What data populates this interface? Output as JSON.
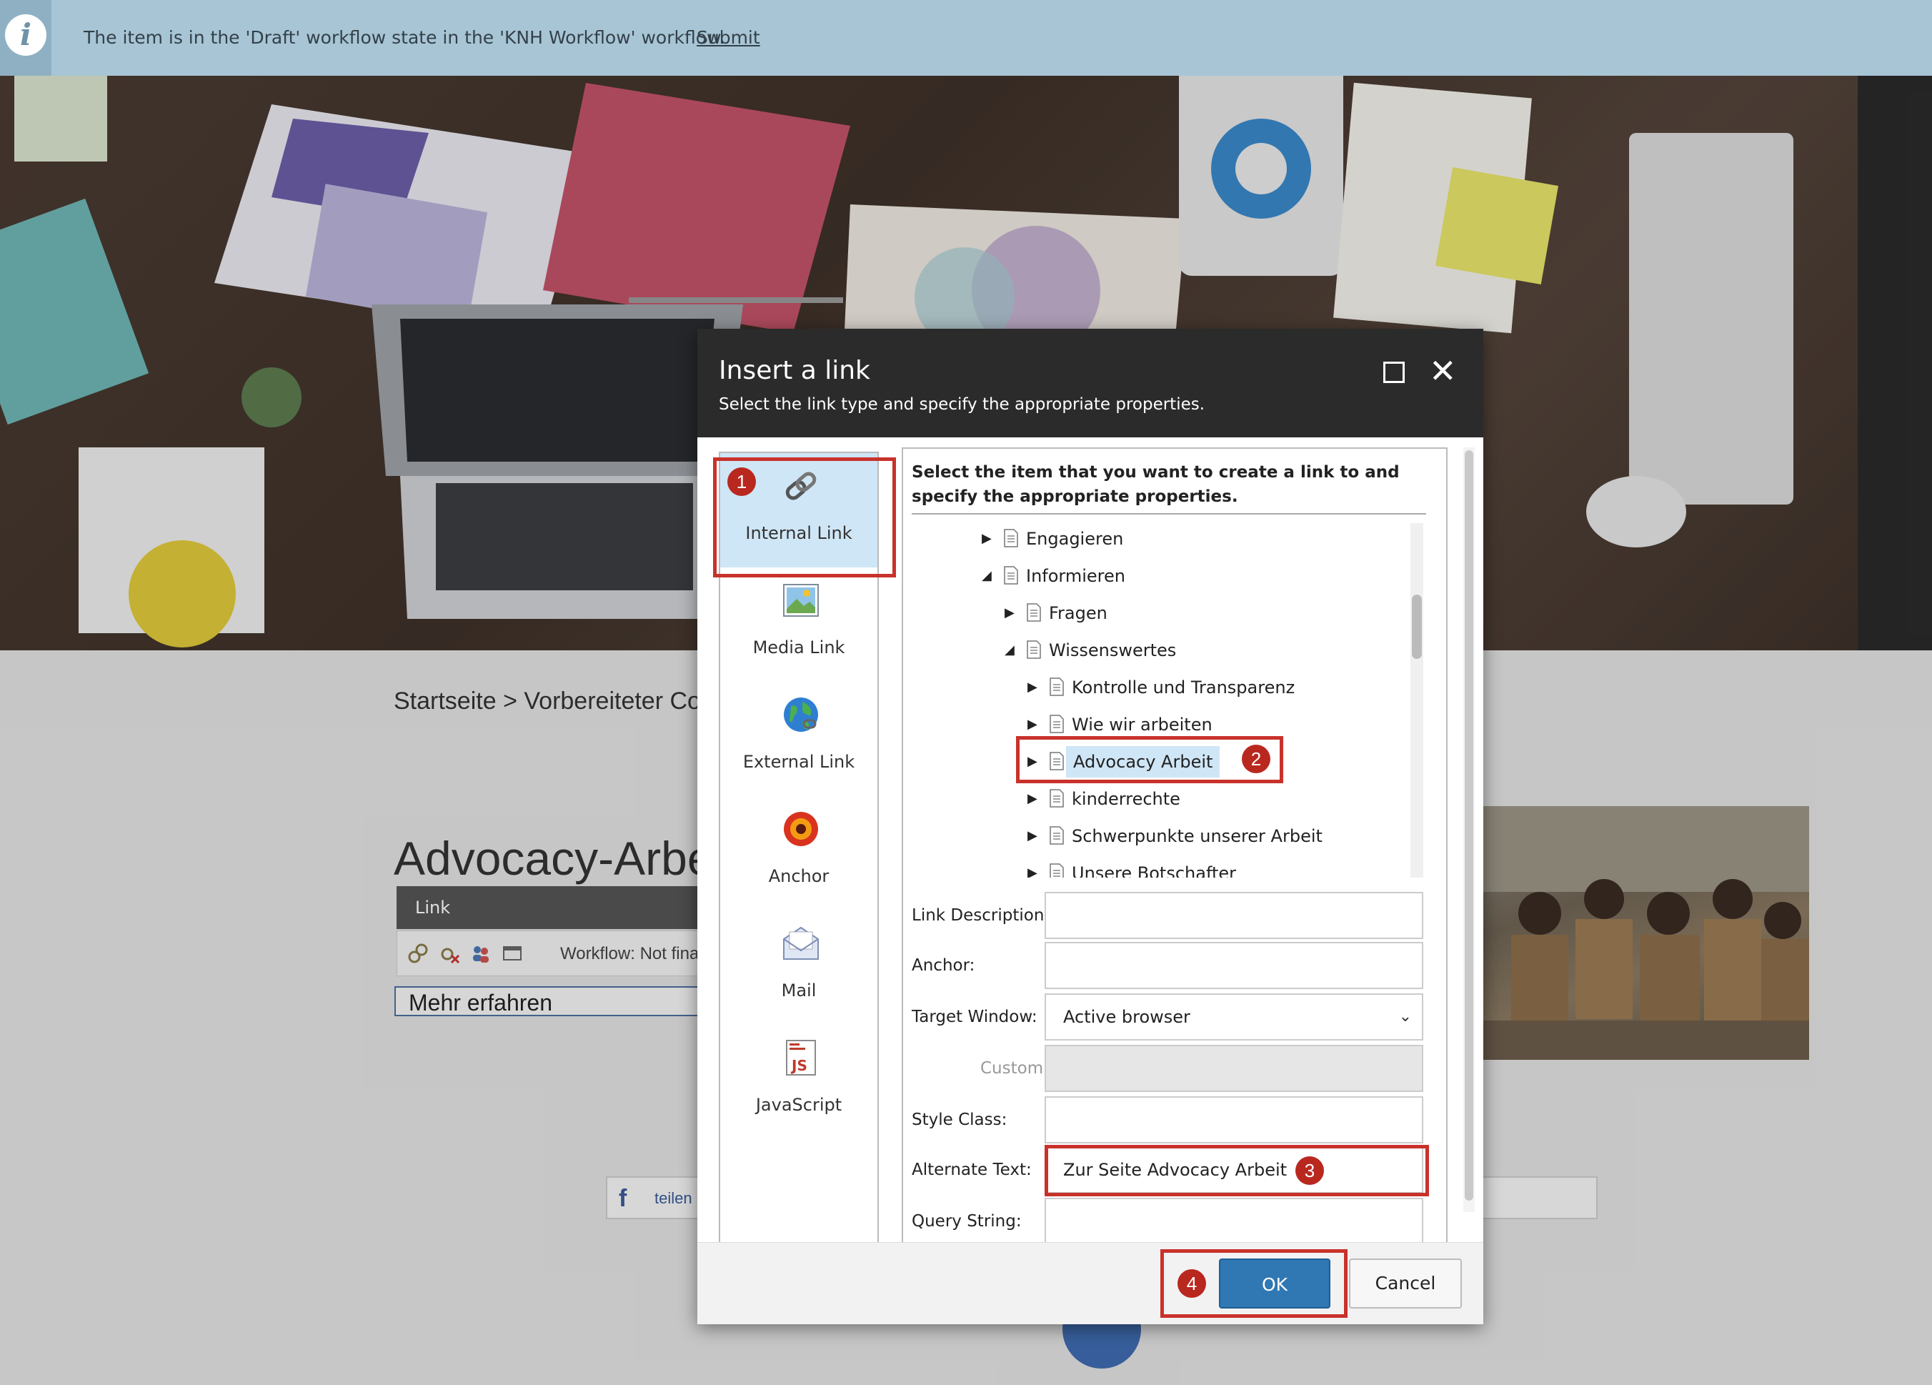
{
  "infobar": {
    "message": "The item is in the 'Draft' workflow state in the 'KNH Workflow' workflow.",
    "submit_label": "Submit",
    "icon": "info-icon"
  },
  "page": {
    "breadcrumb": "Startseite > Vorbereiteter Co",
    "heading": "Advocacy-Arbe",
    "link_panel": {
      "header": "Link",
      "workflow": "Workflow: Not fina",
      "link_text": "Mehr erfahren"
    },
    "share_label": "teilen",
    "scroll_top_icon": "chevron-up-icon"
  },
  "dialog": {
    "title": "Insert a link",
    "subtitle": "Select the link type and specify the appropriate properties.",
    "link_types": [
      {
        "label": "Internal Link",
        "icon": "chain-link-icon",
        "selected": true
      },
      {
        "label": "Media Link",
        "icon": "image-icon"
      },
      {
        "label": "External Link",
        "icon": "globe-icon"
      },
      {
        "label": "Anchor",
        "icon": "target-icon"
      },
      {
        "label": "Mail",
        "icon": "envelope-icon"
      },
      {
        "label": "JavaScript",
        "icon": "js-file-icon"
      }
    ],
    "instructions": "Select the item that you want to create a link to and specify the appropriate properties.",
    "tree": [
      {
        "label": "Engagieren",
        "expanded": false
      },
      {
        "label": "Informieren",
        "expanded": true
      },
      {
        "label": "Fragen",
        "expanded": false
      },
      {
        "label": "Wissenswertes",
        "expanded": true
      },
      {
        "label": "Kontrolle und Transparenz",
        "expanded": false
      },
      {
        "label": "Wie wir arbeiten",
        "expanded": false
      },
      {
        "label": "Advocacy Arbeit",
        "expanded": false,
        "selected": true
      },
      {
        "label": "kinderrechte",
        "expanded": false
      },
      {
        "label": "Schwerpunkte unserer Arbeit",
        "expanded": false
      },
      {
        "label": "Unsere Botschafter",
        "expanded": false
      }
    ],
    "form": {
      "link_description_label": "Link Description:",
      "link_description_value": "",
      "anchor_label": "Anchor:",
      "anchor_value": "",
      "target_window_label": "Target Window:",
      "target_window_value": "Active browser",
      "custom_label": "Custom:",
      "style_class_label": "Style Class:",
      "style_class_value": "",
      "alternate_text_label": "Alternate Text:",
      "alternate_text_value": "Zur Seite Advocacy Arbeit",
      "query_string_label": "Query String:",
      "query_string_value": ""
    },
    "ok_label": "OK",
    "cancel_label": "Cancel"
  },
  "callouts": [
    "1",
    "2",
    "3",
    "4"
  ],
  "colors": {
    "infobar": "#a8c5d5",
    "dialog_header": "#2b2b2b",
    "selected_bg": "#cfe6f6",
    "ok_button": "#2f78b3",
    "callout_red": "#c8322b"
  }
}
